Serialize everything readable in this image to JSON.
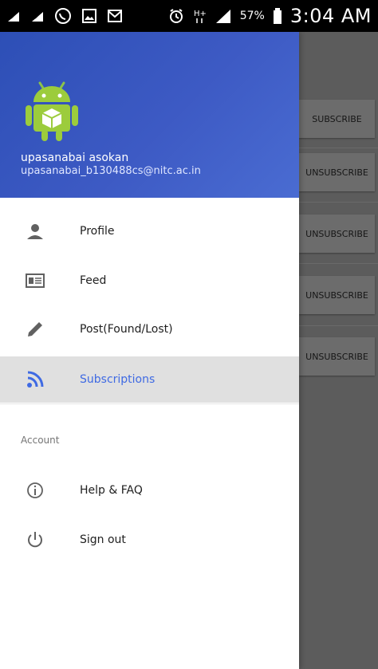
{
  "status_bar": {
    "battery_text": "57%",
    "time": "3:04 AM",
    "icons": [
      "cleanup-icon",
      "cleanup-icon",
      "whatsapp-icon",
      "gallery-icon",
      "gmail-icon",
      "alarm-icon",
      "network-hplus-icon",
      "signal-icon",
      "battery-icon"
    ]
  },
  "drawer": {
    "header": {
      "user_name": "upasanabai asokan",
      "user_email": "upasanabai_b130488cs@nitc.ac.in"
    },
    "nav_items": [
      {
        "label": "Profile",
        "icon": "person-icon"
      },
      {
        "label": "Feed",
        "icon": "newspaper-icon"
      },
      {
        "label": "Post(Found/Lost)",
        "icon": "pencil-icon"
      },
      {
        "label": "Subscriptions",
        "icon": "rss-icon",
        "active": true
      }
    ],
    "section_label": "Account",
    "account_items": [
      {
        "label": "Help & FAQ",
        "icon": "info-icon"
      },
      {
        "label": "Sign out",
        "icon": "power-icon"
      }
    ],
    "active_color": "#3f6ae3"
  },
  "background": {
    "buttons": [
      "SUBSCRIBE",
      "UNSUBSCRIBE",
      "UNSUBSCRIBE",
      "UNSUBSCRIBE",
      "UNSUBSCRIBE"
    ]
  }
}
